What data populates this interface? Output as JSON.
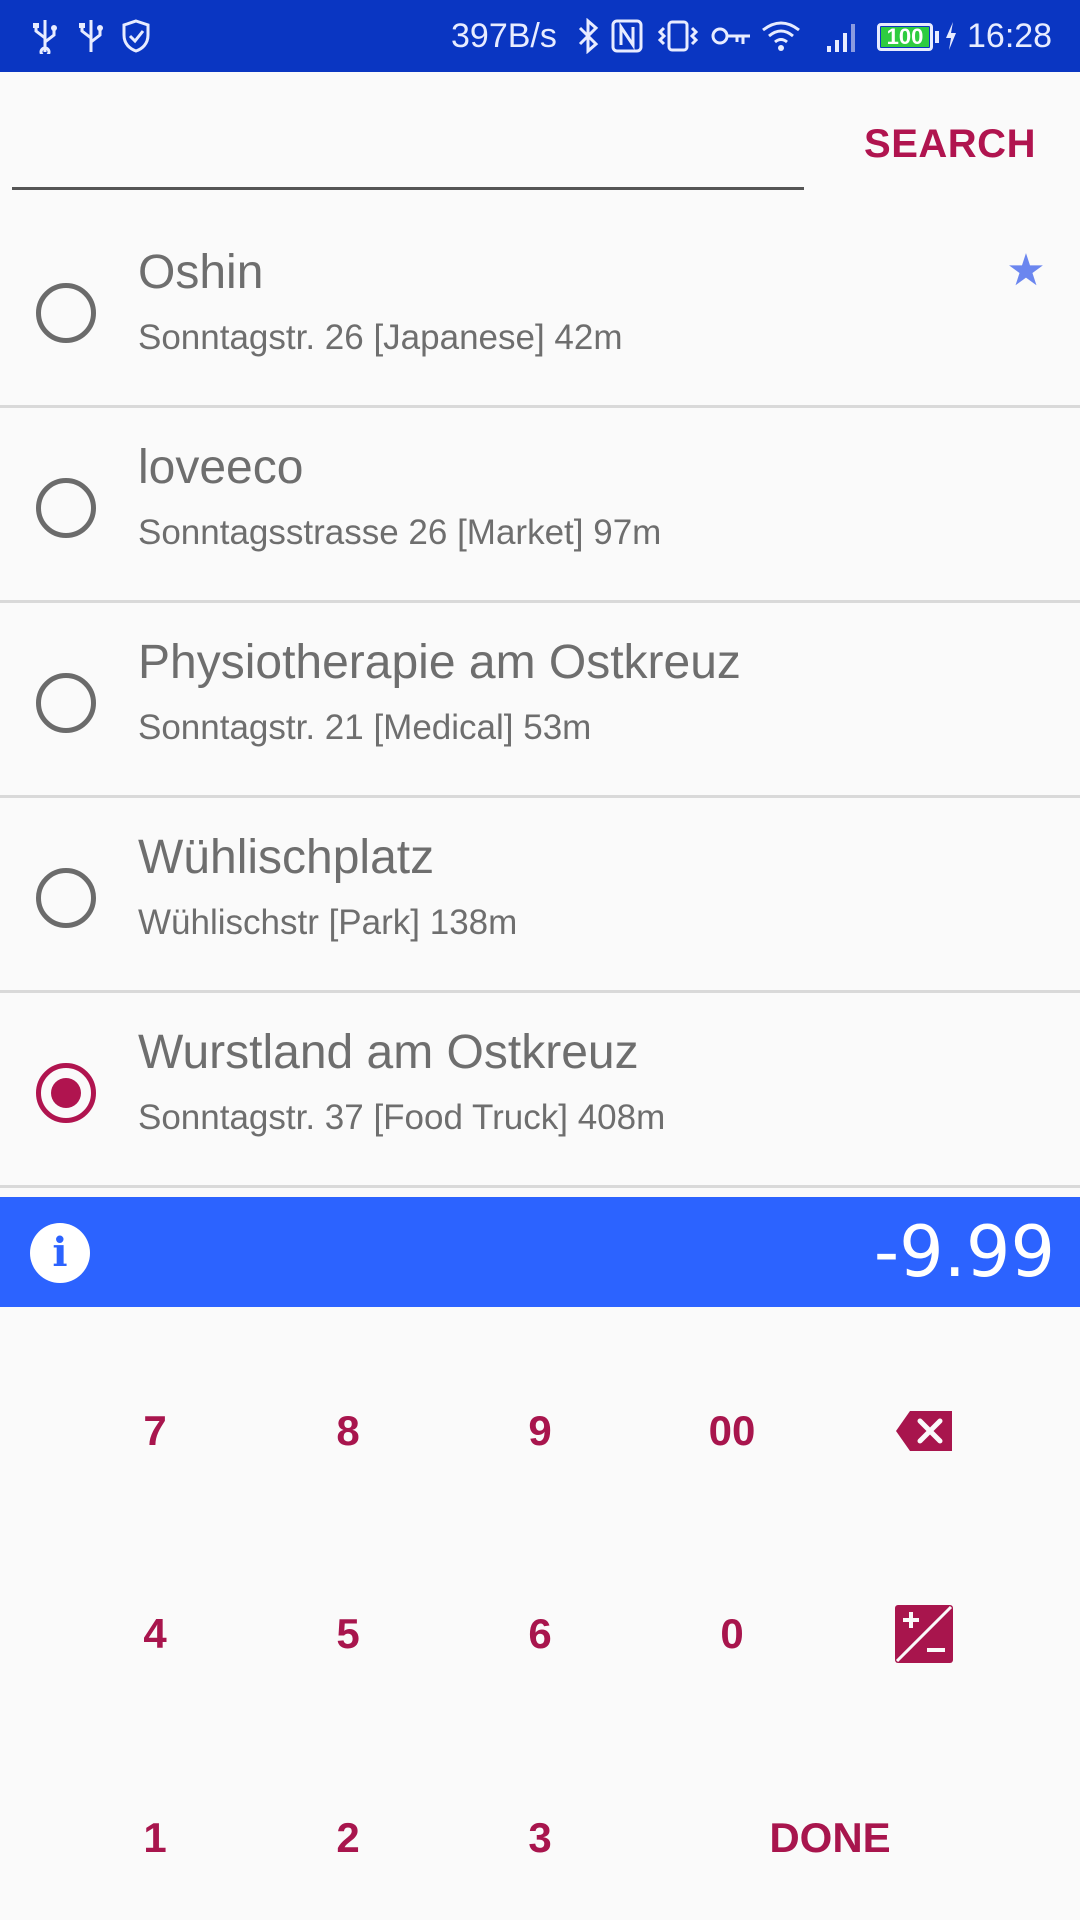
{
  "status_bar": {
    "network_speed": "397B/s",
    "battery_level": "100",
    "time": "16:28",
    "icons": [
      "usb-icon",
      "usb-icon",
      "shield-icon",
      "bluetooth-icon",
      "nfc-icon",
      "vibrate-icon",
      "key-icon",
      "wifi-icon",
      "signal-icon",
      "battery-icon",
      "charging-icon"
    ]
  },
  "search": {
    "value": "",
    "placeholder": "",
    "button_label": "SEARCH"
  },
  "places": [
    {
      "name": "Oshin",
      "detail": "Sonntagstr. 26 [Japanese] 42m",
      "selected": false,
      "favorite": true
    },
    {
      "name": "loveeco",
      "detail": "Sonntagsstrasse 26 [Market] 97m",
      "selected": false,
      "favorite": false
    },
    {
      "name": "Physiotherapie am Ostkreuz",
      "detail": "Sonntagstr. 21 [Medical] 53m",
      "selected": false,
      "favorite": false
    },
    {
      "name": "Wühlischplatz",
      "detail": "Wühlischstr [Park] 138m",
      "selected": false,
      "favorite": false
    },
    {
      "name": "Wurstland am Ostkreuz",
      "detail": "Sonntagstr. 37 [Food Truck] 408m",
      "selected": true,
      "favorite": false
    }
  ],
  "info_bar": {
    "info_icon": "info-icon",
    "amount": "-9.99"
  },
  "keypad": {
    "k7": "7",
    "k8": "8",
    "k9": "9",
    "k00": "00",
    "k4": "4",
    "k5": "5",
    "k6": "6",
    "k0": "0",
    "k1": "1",
    "k2": "2",
    "k3": "3",
    "done": "DONE",
    "backspace_icon": "backspace-icon",
    "plus_minus_icon": "plus-minus-icon"
  },
  "colors": {
    "status_bar": "#0a36c2",
    "accent": "#b0144f",
    "info_bar": "#2c63ff",
    "star": "#6b86ef"
  }
}
